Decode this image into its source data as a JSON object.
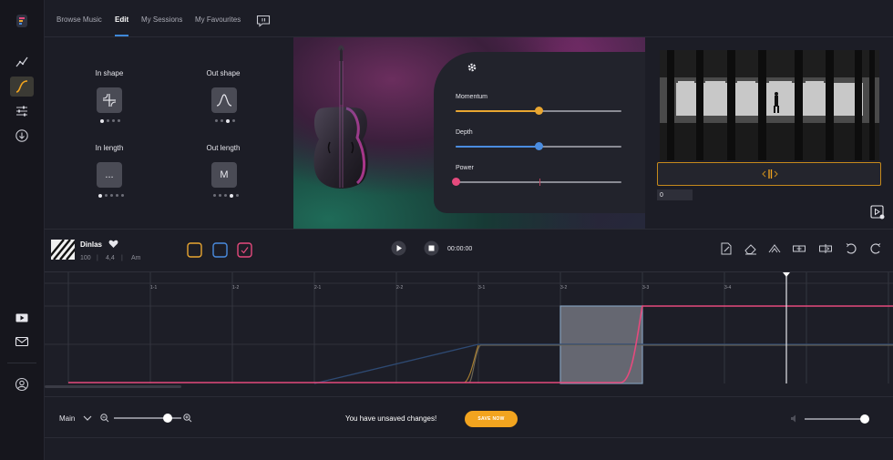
{
  "tabs": [
    {
      "label": "Browse Music",
      "active": false
    },
    {
      "label": "Edit",
      "active": true
    },
    {
      "label": "My Sessions",
      "active": false
    },
    {
      "label": "My Favourites",
      "active": false
    }
  ],
  "shape_panel": {
    "in_shape": {
      "label": "In shape",
      "icon": "cross-curve-icon"
    },
    "out_shape": {
      "label": "Out shape",
      "icon": "bell-curve-icon"
    },
    "in_length": {
      "label": "In length",
      "value": "..."
    },
    "out_length": {
      "label": "Out length",
      "value": "M"
    }
  },
  "sliders": {
    "momentum": {
      "label": "Momentum",
      "value": 0.5,
      "color": "#e9a631"
    },
    "depth": {
      "label": "Depth",
      "value": 0.5,
      "color": "#4a8ce0"
    },
    "power": {
      "label": "Power",
      "value": 0.0,
      "color": "#e54a7d"
    }
  },
  "preview": {
    "frame_value": "0"
  },
  "track": {
    "name": "Dinlas",
    "bpm": "100",
    "signature": "4,4",
    "key": "Am",
    "time": "00:00:00",
    "swatches": [
      "#e9a631",
      "#4a8ce0",
      "#e54a7d"
    ]
  },
  "timeline": {
    "markers": [
      "1-1",
      "1-2",
      "2-1",
      "2-2",
      "3-1",
      "3-2",
      "3-3",
      "3-4"
    ]
  },
  "bottom": {
    "view": "Main",
    "zoom_level": 0.8,
    "message": "You have unsaved changes!",
    "save_label": "SAVE NOW",
    "volume_level": 1.0
  },
  "colors": {
    "accent": "#f2a41f",
    "pink": "#e54a7d",
    "blue": "#4a8ce0",
    "amber": "#e9a631"
  }
}
